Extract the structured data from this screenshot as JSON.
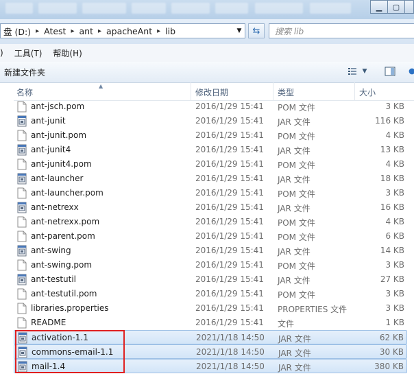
{
  "address": {
    "crumbs": [
      "盘 (D:)",
      "Atest",
      "ant",
      "apacheAnt",
      "lib"
    ]
  },
  "search": {
    "placeholder": "搜索 lib"
  },
  "menu": {
    "items": [
      ")",
      "工具(T)",
      "帮助(H)"
    ]
  },
  "toolbar": {
    "new_folder_label": "新建文件夹"
  },
  "columns": {
    "name": "名称",
    "date": "修改日期",
    "type": "类型",
    "size": "大小"
  },
  "files": [
    {
      "name": "ant-jsch.pom",
      "date": "2016/1/29 15:41",
      "type": "POM 文件",
      "size": "3 KB",
      "icon": "document-icon",
      "selected": false
    },
    {
      "name": "ant-junit",
      "date": "2016/1/29 15:41",
      "type": "JAR 文件",
      "size": "116 KB",
      "icon": "jar-file-icon",
      "selected": false
    },
    {
      "name": "ant-junit.pom",
      "date": "2016/1/29 15:41",
      "type": "POM 文件",
      "size": "4 KB",
      "icon": "document-icon",
      "selected": false
    },
    {
      "name": "ant-junit4",
      "date": "2016/1/29 15:41",
      "type": "JAR 文件",
      "size": "13 KB",
      "icon": "jar-file-icon",
      "selected": false
    },
    {
      "name": "ant-junit4.pom",
      "date": "2016/1/29 15:41",
      "type": "POM 文件",
      "size": "4 KB",
      "icon": "document-icon",
      "selected": false
    },
    {
      "name": "ant-launcher",
      "date": "2016/1/29 15:41",
      "type": "JAR 文件",
      "size": "18 KB",
      "icon": "jar-file-icon",
      "selected": false
    },
    {
      "name": "ant-launcher.pom",
      "date": "2016/1/29 15:41",
      "type": "POM 文件",
      "size": "3 KB",
      "icon": "document-icon",
      "selected": false
    },
    {
      "name": "ant-netrexx",
      "date": "2016/1/29 15:41",
      "type": "JAR 文件",
      "size": "16 KB",
      "icon": "jar-file-icon",
      "selected": false
    },
    {
      "name": "ant-netrexx.pom",
      "date": "2016/1/29 15:41",
      "type": "POM 文件",
      "size": "4 KB",
      "icon": "document-icon",
      "selected": false
    },
    {
      "name": "ant-parent.pom",
      "date": "2016/1/29 15:41",
      "type": "POM 文件",
      "size": "6 KB",
      "icon": "document-icon",
      "selected": false
    },
    {
      "name": "ant-swing",
      "date": "2016/1/29 15:41",
      "type": "JAR 文件",
      "size": "14 KB",
      "icon": "jar-file-icon",
      "selected": false
    },
    {
      "name": "ant-swing.pom",
      "date": "2016/1/29 15:41",
      "type": "POM 文件",
      "size": "3 KB",
      "icon": "document-icon",
      "selected": false
    },
    {
      "name": "ant-testutil",
      "date": "2016/1/29 15:41",
      "type": "JAR 文件",
      "size": "27 KB",
      "icon": "jar-file-icon",
      "selected": false
    },
    {
      "name": "ant-testutil.pom",
      "date": "2016/1/29 15:41",
      "type": "POM 文件",
      "size": "3 KB",
      "icon": "document-icon",
      "selected": false
    },
    {
      "name": "libraries.properties",
      "date": "2016/1/29 15:41",
      "type": "PROPERTIES 文件",
      "size": "3 KB",
      "icon": "document-icon",
      "selected": false
    },
    {
      "name": "README",
      "date": "2016/1/29 15:41",
      "type": "文件",
      "size": "1 KB",
      "icon": "document-icon",
      "selected": false
    },
    {
      "name": "activation-1.1",
      "date": "2021/1/18 14:50",
      "type": "JAR 文件",
      "size": "62 KB",
      "icon": "jar-file-icon",
      "selected": true
    },
    {
      "name": "commons-email-1.1",
      "date": "2021/1/18 14:50",
      "type": "JAR 文件",
      "size": "30 KB",
      "icon": "jar-file-icon",
      "selected": true
    },
    {
      "name": "mail-1.4",
      "date": "2021/1/18 14:50",
      "type": "JAR 文件",
      "size": "380 KB",
      "icon": "jar-file-icon",
      "selected": true
    }
  ],
  "colors": {
    "selection": "#d3e5f8",
    "highlight_border": "#e02020",
    "title_bar": "#b6cfe8"
  }
}
